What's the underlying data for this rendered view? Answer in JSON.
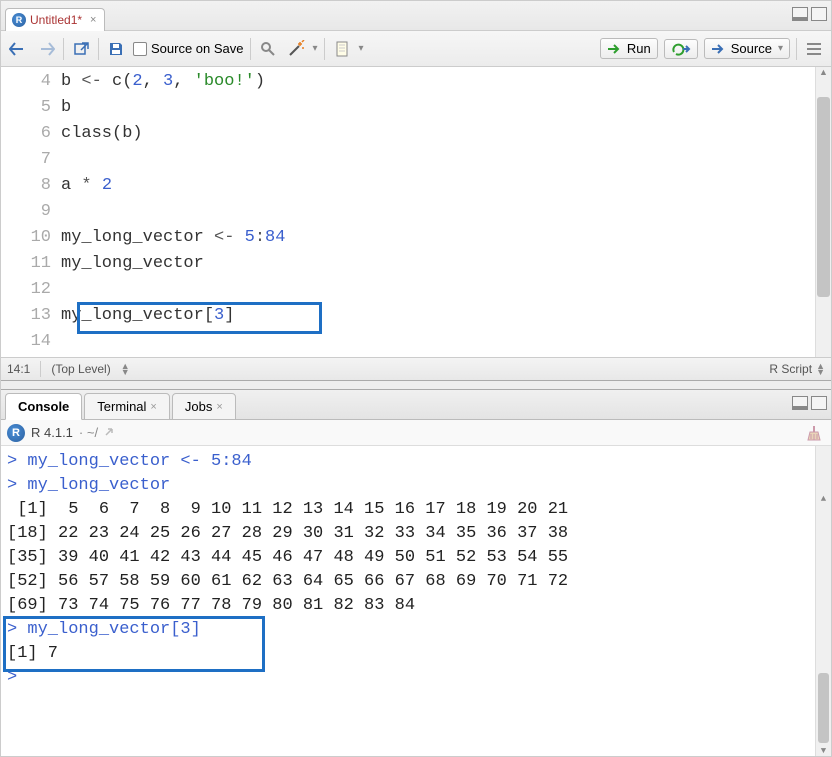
{
  "tab": {
    "title": "Untitled1*"
  },
  "toolbar": {
    "source_on_save": "Source on Save",
    "run": "Run",
    "source": "Source"
  },
  "editor": {
    "gutter_start": 4,
    "gutter_end": 14,
    "lines": [
      {
        "tokens": [
          [
            "p",
            "b "
          ],
          [
            "op",
            "<-"
          ],
          [
            "p",
            " c("
          ],
          [
            "num",
            "2"
          ],
          [
            "p",
            ", "
          ],
          [
            "num",
            "3"
          ],
          [
            "p",
            ", "
          ],
          [
            "str",
            "'boo!'"
          ],
          [
            "p",
            ")"
          ]
        ]
      },
      {
        "tokens": [
          [
            "p",
            "b"
          ]
        ]
      },
      {
        "tokens": [
          [
            "p",
            "class(b)"
          ]
        ]
      },
      {
        "tokens": [
          [
            "p",
            ""
          ]
        ]
      },
      {
        "tokens": [
          [
            "p",
            "a "
          ],
          [
            "op",
            "*"
          ],
          [
            "p",
            " "
          ],
          [
            "num",
            "2"
          ]
        ]
      },
      {
        "tokens": [
          [
            "p",
            ""
          ]
        ]
      },
      {
        "tokens": [
          [
            "p",
            "my_long_vector "
          ],
          [
            "op",
            "<-"
          ],
          [
            "p",
            " "
          ],
          [
            "num",
            "5"
          ],
          [
            "op",
            ":"
          ],
          [
            "num",
            "84"
          ]
        ]
      },
      {
        "tokens": [
          [
            "p",
            "my_long_vector"
          ]
        ]
      },
      {
        "tokens": [
          [
            "p",
            ""
          ]
        ]
      },
      {
        "tokens": [
          [
            "p",
            "my_long_vector["
          ],
          [
            "num",
            "3"
          ],
          [
            "p",
            "]"
          ]
        ]
      },
      {
        "tokens": [
          [
            "p",
            ""
          ]
        ]
      }
    ]
  },
  "status": {
    "cursor": "14:1",
    "scope": "(Top Level)",
    "lang": "R Script"
  },
  "console_tabs": {
    "console": "Console",
    "terminal": "Terminal",
    "jobs": "Jobs"
  },
  "console_header": {
    "version": "R 4.1.1",
    "path": "· ~/"
  },
  "console": {
    "lines": [
      {
        "type": "prompt",
        "text": "> my_long_vector <- 5:84"
      },
      {
        "type": "prompt",
        "text": "> my_long_vector"
      },
      {
        "type": "plain",
        "text": " [1]  5  6  7  8  9 10 11 12 13 14 15 16 17 18 19 20 21"
      },
      {
        "type": "plain",
        "text": "[18] 22 23 24 25 26 27 28 29 30 31 32 33 34 35 36 37 38"
      },
      {
        "type": "plain",
        "text": "[35] 39 40 41 42 43 44 45 46 47 48 49 50 51 52 53 54 55"
      },
      {
        "type": "plain",
        "text": "[52] 56 57 58 59 60 61 62 63 64 65 66 67 68 69 70 71 72"
      },
      {
        "type": "plain",
        "text": "[69] 73 74 75 76 77 78 79 80 81 82 83 84"
      },
      {
        "type": "prompt",
        "text": "> my_long_vector[3]"
      },
      {
        "type": "plain",
        "text": "[1] 7"
      },
      {
        "type": "prompt",
        "text": ">"
      }
    ]
  }
}
